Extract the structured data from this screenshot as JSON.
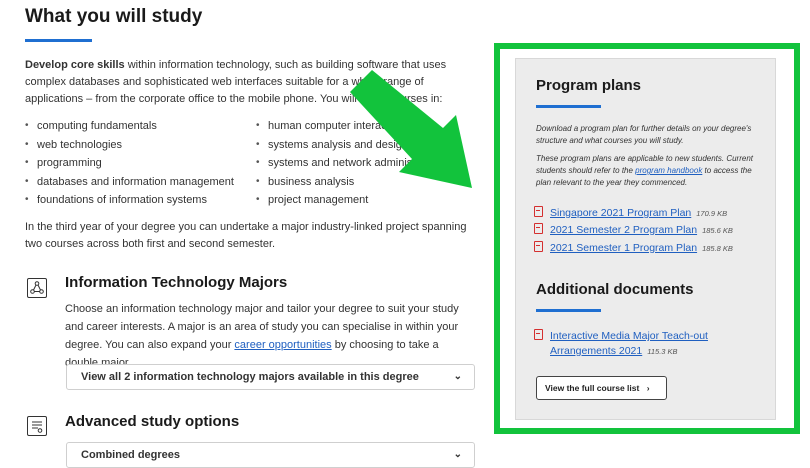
{
  "main": {
    "title": "What you will study",
    "intro_strong": "Develop core skills",
    "intro_rest": " within information technology, such as building software that uses complex databases and sophisticated web interfaces suitable for a whole range of applications – from the corporate office to the mobile phone. You will study courses in:",
    "list_left": [
      "computing fundamentals",
      "web technologies",
      "programming",
      "databases and information management",
      "foundations of information systems"
    ],
    "list_right": [
      "human computer interaction",
      "systems analysis and design",
      "systems and network administration",
      "business analysis",
      "project management"
    ],
    "third_year": "In the third year of your degree you can undertake a major industry-linked project spanning two courses across both first and second semester.",
    "majors": {
      "title": "Information Technology Majors",
      "text_before": "Choose an information technology major and tailor your degree to suit your study and career interests. A major is an area of study you can specialise in within your degree. You can also expand your ",
      "link": "career opportunities",
      "text_after": " by choosing to take a double major.",
      "dropdown": "View all 2 information technology majors available in this degree"
    },
    "advanced": {
      "title": "Advanced study options",
      "dropdown": "Combined degrees"
    }
  },
  "sidebar": {
    "program_plans_title": "Program plans",
    "desc1": "Download a program plan for further details on your degree's structure and what courses you will study.",
    "desc2_before": "These program plans are applicable to new students. Current students should refer to the ",
    "desc2_link": "program handbook",
    "desc2_after": " to access the plan relevant to the year they commenced.",
    "plans": [
      {
        "label": "Singapore 2021 Program Plan",
        "size": "170.9 KB"
      },
      {
        "label": "2021 Semester 2 Program Plan",
        "size": "185.6 KB"
      },
      {
        "label": "2021 Semester 1 Program Plan",
        "size": "185.8 KB"
      }
    ],
    "additional_title": "Additional documents",
    "doc_line1": "Interactive Media Major Teach-out",
    "doc_line2": "Arrangements 2021",
    "doc_size": "115.3 KB",
    "full_list_button": "View the full course list",
    "full_list_chevron": "›"
  },
  "colors": {
    "accent": "#1f6fd1",
    "highlight_green": "#12c33c",
    "pdf_red": "#d42f2f"
  }
}
